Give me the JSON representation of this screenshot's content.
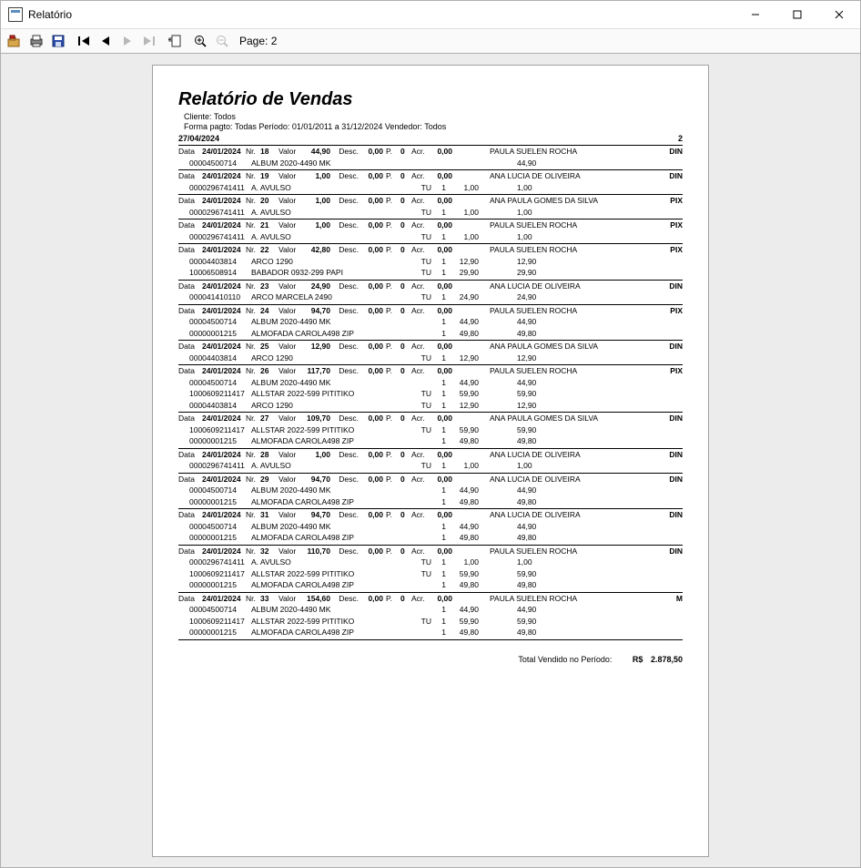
{
  "window": {
    "title": "Relatório"
  },
  "toolbar": {
    "page_label": "Page: 2"
  },
  "header": {
    "title": "Relatório de Vendas",
    "line1": "Cliente: Todos",
    "line2": "Forma pagto: Todas   Período: 01/01/2011 a 31/12/2024  Vendedor: Todos",
    "date_printed": "27/04/2024",
    "page_number": "2"
  },
  "labels": {
    "data": "Data",
    "nr": "Nr.",
    "valor": "Valor",
    "desc": "Desc.",
    "p": "P.",
    "acr": "Acr."
  },
  "sales": [
    {
      "data": "24/01/2024",
      "nr": "18",
      "valor": "44,90",
      "desc": "0,00",
      "p": "0",
      "acr": "0,00",
      "seller": "PAULA SUELEN ROCHA",
      "pay": "DIN",
      "items": [
        {
          "code": "00004500714",
          "name": "ALBUM 2020-4490 MK",
          "tu": "",
          "q": "",
          "price": "",
          "total": "44,90"
        }
      ]
    },
    {
      "data": "24/01/2024",
      "nr": "19",
      "valor": "1,00",
      "desc": "0,00",
      "p": "0",
      "acr": "0,00",
      "seller": "ANA LUCIA DE OLIVEIRA",
      "pay": "DIN",
      "items": [
        {
          "code": "0000296741411",
          "name": "A. AVULSO",
          "tu": "TU",
          "q": "1",
          "price": "1,00",
          "total": "1,00"
        }
      ]
    },
    {
      "data": "24/01/2024",
      "nr": "20",
      "valor": "1,00",
      "desc": "0,00",
      "p": "0",
      "acr": "0,00",
      "seller": "ANA PAULA GOMES DA SILVA",
      "pay": "PIX",
      "items": [
        {
          "code": "0000296741411",
          "name": "A. AVULSO",
          "tu": "TU",
          "q": "1",
          "price": "1,00",
          "total": "1,00"
        }
      ]
    },
    {
      "data": "24/01/2024",
      "nr": "21",
      "valor": "1,00",
      "desc": "0,00",
      "p": "0",
      "acr": "0,00",
      "seller": "PAULA SUELEN ROCHA",
      "pay": "PIX",
      "items": [
        {
          "code": "0000296741411",
          "name": "A. AVULSO",
          "tu": "TU",
          "q": "1",
          "price": "1,00",
          "total": "1,00"
        }
      ]
    },
    {
      "data": "24/01/2024",
      "nr": "22",
      "valor": "42,80",
      "desc": "0,00",
      "p": "0",
      "acr": "0,00",
      "seller": "PAULA SUELEN ROCHA",
      "pay": "PIX",
      "items": [
        {
          "code": "00004403814",
          "name": "ARCO 1290",
          "tu": "TU",
          "q": "1",
          "price": "12,90",
          "total": "12,90"
        },
        {
          "code": "10006508914",
          "name": "BABADOR 0932-299 PAPI",
          "tu": "TU",
          "q": "1",
          "price": "29,90",
          "total": "29,90"
        }
      ]
    },
    {
      "data": "24/01/2024",
      "nr": "23",
      "valor": "24,90",
      "desc": "0,00",
      "p": "0",
      "acr": "0,00",
      "seller": "ANA LUCIA DE OLIVEIRA",
      "pay": "DIN",
      "items": [
        {
          "code": "000041410110",
          "name": "ARCO MARCELA 2490",
          "tu": "TU",
          "q": "1",
          "price": "24,90",
          "total": "24,90"
        }
      ]
    },
    {
      "data": "24/01/2024",
      "nr": "24",
      "valor": "94,70",
      "desc": "0,00",
      "p": "0",
      "acr": "0,00",
      "seller": "PAULA SUELEN ROCHA",
      "pay": "PIX",
      "items": [
        {
          "code": "00004500714",
          "name": "ALBUM 2020-4490 MK",
          "tu": "",
          "q": "1",
          "price": "44,90",
          "total": "44,90"
        },
        {
          "code": "00000001215",
          "name": "ALMOFADA CAROLA498 ZIP",
          "tu": "",
          "q": "1",
          "price": "49,80",
          "total": "49,80"
        }
      ]
    },
    {
      "data": "24/01/2024",
      "nr": "25",
      "valor": "12,90",
      "desc": "0,00",
      "p": "0",
      "acr": "0,00",
      "seller": "ANA PAULA GOMES DA SILVA",
      "pay": "DIN",
      "items": [
        {
          "code": "00004403814",
          "name": "ARCO 1290",
          "tu": "TU",
          "q": "1",
          "price": "12,90",
          "total": "12,90"
        }
      ]
    },
    {
      "data": "24/01/2024",
      "nr": "26",
      "valor": "117,70",
      "desc": "0,00",
      "p": "0",
      "acr": "0,00",
      "seller": "PAULA SUELEN ROCHA",
      "pay": "PIX",
      "items": [
        {
          "code": "00004500714",
          "name": "ALBUM 2020-4490 MK",
          "tu": "",
          "q": "1",
          "price": "44,90",
          "total": "44,90"
        },
        {
          "code": "1000609211417",
          "name": "ALLSTAR 2022-599 PITITIKO",
          "tu": "TU",
          "q": "1",
          "price": "59,90",
          "total": "59,90"
        },
        {
          "code": "00004403814",
          "name": "ARCO 1290",
          "tu": "TU",
          "q": "1",
          "price": "12,90",
          "total": "12,90"
        }
      ]
    },
    {
      "data": "24/01/2024",
      "nr": "27",
      "valor": "109,70",
      "desc": "0,00",
      "p": "0",
      "acr": "0,00",
      "seller": "ANA PAULA GOMES DA SILVA",
      "pay": "DIN",
      "items": [
        {
          "code": "1000609211417",
          "name": "ALLSTAR 2022-599 PITITIKO",
          "tu": "TU",
          "q": "1",
          "price": "59,90",
          "total": "59,90"
        },
        {
          "code": "00000001215",
          "name": "ALMOFADA CAROLA498 ZIP",
          "tu": "",
          "q": "1",
          "price": "49,80",
          "total": "49,80"
        }
      ]
    },
    {
      "data": "24/01/2024",
      "nr": "28",
      "valor": "1,00",
      "desc": "0,00",
      "p": "0",
      "acr": "0,00",
      "seller": "ANA LUCIA DE OLIVEIRA",
      "pay": "DIN",
      "items": [
        {
          "code": "0000296741411",
          "name": "A. AVULSO",
          "tu": "TU",
          "q": "1",
          "price": "1,00",
          "total": "1,00"
        }
      ]
    },
    {
      "data": "24/01/2024",
      "nr": "29",
      "valor": "94,70",
      "desc": "0,00",
      "p": "0",
      "acr": "0,00",
      "seller": "ANA LUCIA DE OLIVEIRA",
      "pay": "DIN",
      "items": [
        {
          "code": "00004500714",
          "name": "ALBUM 2020-4490 MK",
          "tu": "",
          "q": "1",
          "price": "44,90",
          "total": "44,90"
        },
        {
          "code": "00000001215",
          "name": "ALMOFADA CAROLA498 ZIP",
          "tu": "",
          "q": "1",
          "price": "49,80",
          "total": "49,80"
        }
      ]
    },
    {
      "data": "24/01/2024",
      "nr": "31",
      "valor": "94,70",
      "desc": "0,00",
      "p": "0",
      "acr": "0,00",
      "seller": "ANA LUCIA DE OLIVEIRA",
      "pay": "DIN",
      "items": [
        {
          "code": "00004500714",
          "name": "ALBUM 2020-4490 MK",
          "tu": "",
          "q": "1",
          "price": "44,90",
          "total": "44,90"
        },
        {
          "code": "00000001215",
          "name": "ALMOFADA CAROLA498 ZIP",
          "tu": "",
          "q": "1",
          "price": "49,80",
          "total": "49,80"
        }
      ]
    },
    {
      "data": "24/01/2024",
      "nr": "32",
      "valor": "110,70",
      "desc": "0,00",
      "p": "0",
      "acr": "0,00",
      "seller": "PAULA SUELEN ROCHA",
      "pay": "DIN",
      "items": [
        {
          "code": "0000296741411",
          "name": "A. AVULSO",
          "tu": "TU",
          "q": "1",
          "price": "1,00",
          "total": "1,00"
        },
        {
          "code": "1000609211417",
          "name": "ALLSTAR 2022-599 PITITIKO",
          "tu": "TU",
          "q": "1",
          "price": "59,90",
          "total": "59,90"
        },
        {
          "code": "00000001215",
          "name": "ALMOFADA CAROLA498 ZIP",
          "tu": "",
          "q": "1",
          "price": "49,80",
          "total": "49,80"
        }
      ]
    },
    {
      "data": "24/01/2024",
      "nr": "33",
      "valor": "154,60",
      "desc": "0,00",
      "p": "0",
      "acr": "0,00",
      "seller": "PAULA SUELEN ROCHA",
      "pay": "M",
      "items": [
        {
          "code": "00004500714",
          "name": "ALBUM 2020-4490 MK",
          "tu": "",
          "q": "1",
          "price": "44,90",
          "total": "44,90"
        },
        {
          "code": "1000609211417",
          "name": "ALLSTAR 2022-599 PITITIKO",
          "tu": "TU",
          "q": "1",
          "price": "59,90",
          "total": "59,90"
        },
        {
          "code": "00000001215",
          "name": "ALMOFADA CAROLA498 ZIP",
          "tu": "",
          "q": "1",
          "price": "49,80",
          "total": "49,80"
        }
      ]
    }
  ],
  "footer": {
    "total_label": "Total Vendido no Período:",
    "currency": "R$",
    "total_value": "2.878,50"
  }
}
